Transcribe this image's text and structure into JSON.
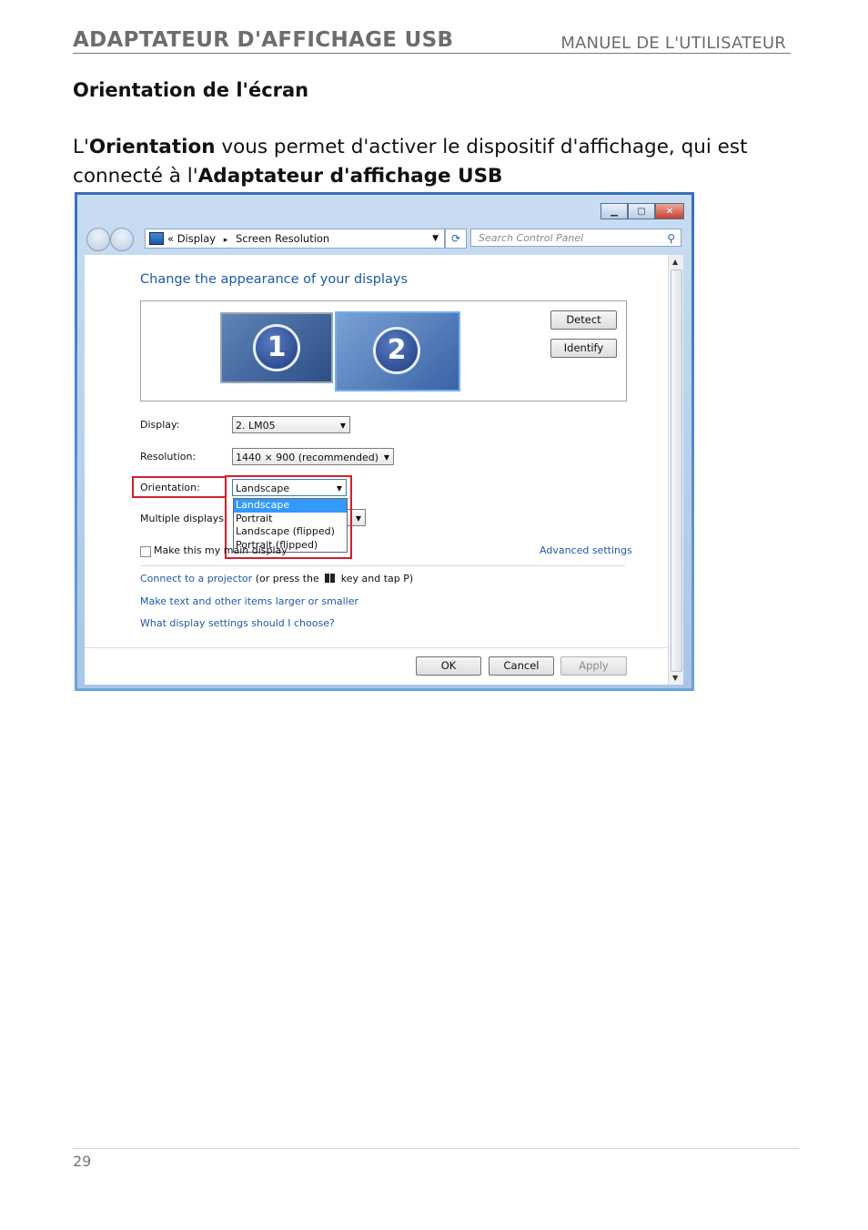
{
  "header": {
    "product": "ADAPTATEUR D'AFFICHAGE USB",
    "manual": "MANUEL DE L'UTILISATEUR"
  },
  "section_title": "Orientation de l'écran",
  "paragraph": {
    "p1": "L'",
    "p2": "Orientation",
    "p3": " vous permet d'activer le dispositif d'affichage, qui est connecté à l'",
    "p4": "Adaptateur d'affichage USB"
  },
  "window": {
    "address": {
      "prefix": "«",
      "crumb1": "Display",
      "sep": "▸",
      "crumb2": "Screen Resolution"
    },
    "search_placeholder": "Search Control Panel",
    "heading": "Change the appearance of your displays",
    "monitors": [
      "1",
      "2"
    ],
    "detect": "Detect",
    "identify": "Identify",
    "display_label": "Display:",
    "display_value": "2. LM05",
    "resolution_label": "Resolution:",
    "resolution_value": "1440 × 900 (recommended)",
    "orientation_label": "Orientation:",
    "orientation_value": "Landscape",
    "orientation_options": [
      "Landscape",
      "Portrait",
      "Landscape (flipped)",
      "Portrait (flipped)"
    ],
    "multiple_label": "Multiple displays:",
    "main_display": "Make this my main display",
    "advanced": "Advanced settings",
    "projector_link": "Connect to a projector",
    "projector_rest1": "(or press the",
    "projector_rest2": "key and tap P)",
    "text_size_link": "Make text and other items larger or smaller",
    "which_link": "What display settings should I choose?",
    "ok": "OK",
    "cancel": "Cancel",
    "apply": "Apply"
  },
  "page_number": "29"
}
